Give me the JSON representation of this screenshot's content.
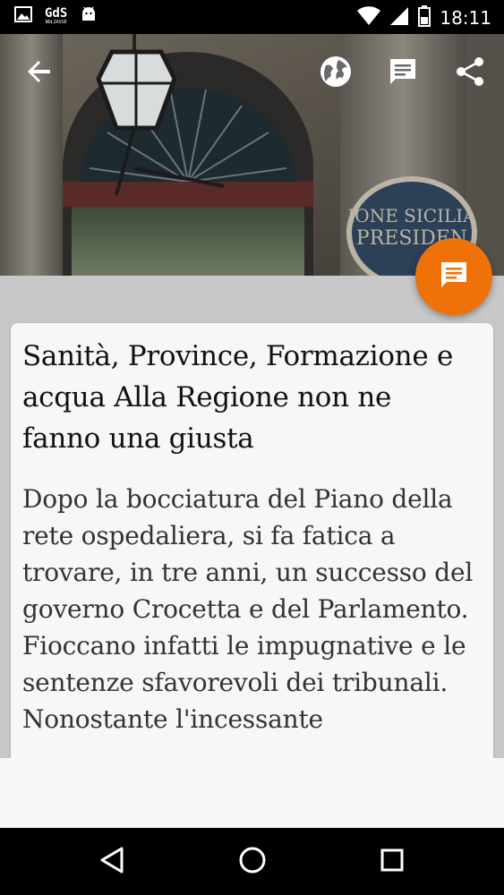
{
  "status_bar": {
    "time": "18:11",
    "gds_logo_text": "GdS",
    "gds_logo_sub": "NOLIASSE"
  },
  "toolbar": {
    "back_icon": "arrow-back-icon",
    "globe_icon": "globe-icon",
    "comment_icon": "comment-icon",
    "share_icon": "share-icon"
  },
  "fab": {
    "icon": "comment-icon",
    "color": "#ee7208"
  },
  "article": {
    "headline": "Sanità, Province, Formazione e acqua Alla Regione non ne fanno una giusta",
    "body": "Dopo la bocciatura del Piano della rete ospedaliera, si fa fatica a trovare, in tre anni, un successo del governo Crocetta e del Parlamento. Fioccano infatti le impugnative e le sentenze sfavorevoli dei tribunali. Nonostante l'incessante"
  },
  "hero_image": {
    "plaque_text_line1": "IONE SICILIA",
    "plaque_text_line2": "PRESIDEN"
  },
  "nav_bar": {
    "back_icon": "triangle-back-icon",
    "home_icon": "circle-home-icon",
    "recents_icon": "square-recents-icon"
  }
}
